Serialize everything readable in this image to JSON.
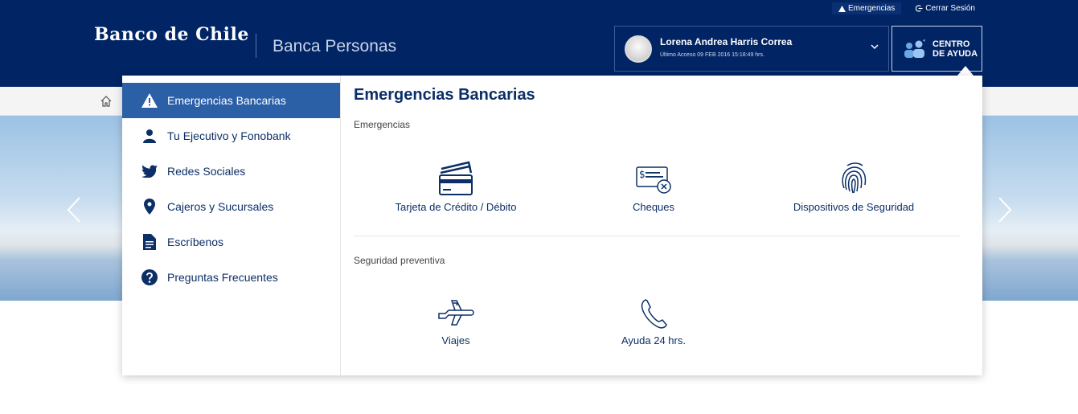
{
  "top_links": {
    "emergencias": "Emergencias",
    "cerrar_sesion": "Cerrar Sesión"
  },
  "header": {
    "logo": "Banco de Chile",
    "subbrand": "Banca Personas"
  },
  "user": {
    "name": "Lorena Andrea Harris Correa",
    "last_access": "Último Acceso 09 FEB 2016 15:18:49 hrs."
  },
  "help": {
    "line1": "CENTRO",
    "line2": "DE AYUDA"
  },
  "sidebar": {
    "items": [
      {
        "label": "Emergencias Bancarias",
        "icon": "warning-icon",
        "active": true
      },
      {
        "label": "Tu Ejecutivo y Fonobank",
        "icon": "person-icon"
      },
      {
        "label": "Redes Sociales",
        "icon": "twitter-icon"
      },
      {
        "label": "Cajeros y Sucursales",
        "icon": "location-pin-icon"
      },
      {
        "label": "Escríbenos",
        "icon": "document-icon"
      },
      {
        "label": "Preguntas Frecuentes",
        "icon": "question-icon"
      }
    ]
  },
  "content": {
    "title": "Emergencias Bancarias",
    "section1": {
      "label": "Emergencias",
      "tiles": [
        {
          "label": "Tarjeta de Crédito / Débito",
          "icon": "credit-card-icon"
        },
        {
          "label": "Cheques",
          "icon": "cheque-icon"
        },
        {
          "label": "Dispositivos de Seguridad",
          "icon": "fingerprint-icon"
        }
      ]
    },
    "section2": {
      "label": "Seguridad preventiva",
      "tiles": [
        {
          "label": "Viajes",
          "icon": "airplane-icon"
        },
        {
          "label": "Ayuda 24 hrs.",
          "icon": "phone-icon"
        }
      ]
    }
  },
  "colors": {
    "header_bg": "#002464",
    "active_item": "#2b5fa6",
    "text_navy": "#0b2f66"
  }
}
